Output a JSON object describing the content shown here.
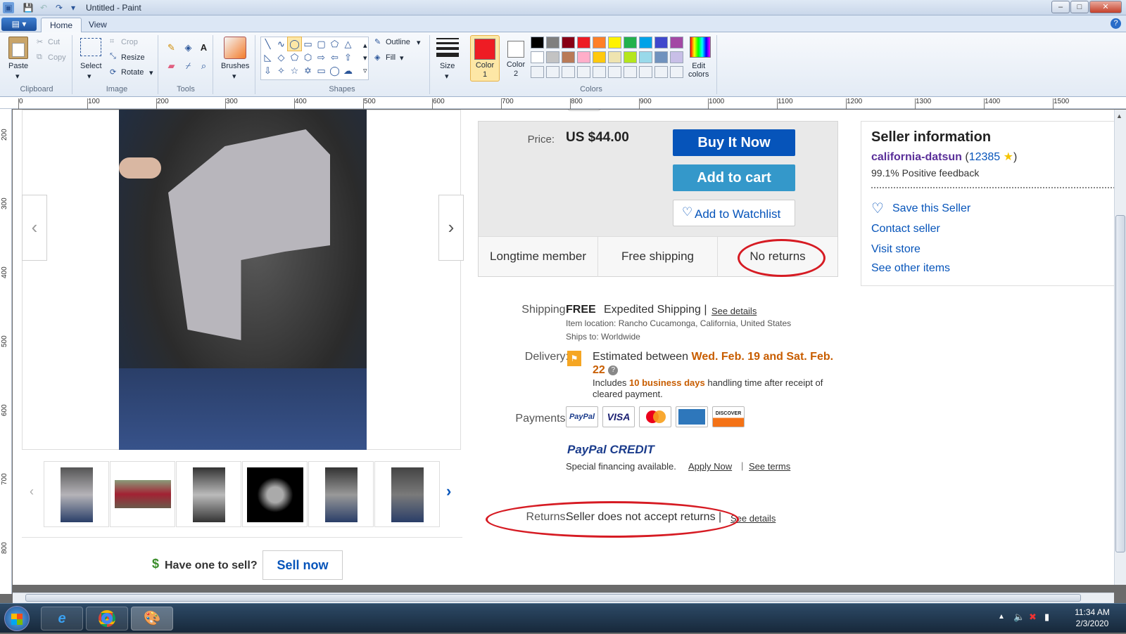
{
  "window": {
    "title": "Untitled - Paint",
    "min": "–",
    "max": "□",
    "close": "✕"
  },
  "ribbon": {
    "file_menu": "▤ ▾",
    "tabs": [
      "Home",
      "View"
    ],
    "clipboard": {
      "paste": "Paste",
      "cut": "Cut",
      "copy": "Copy",
      "label": "Clipboard"
    },
    "image": {
      "select": "Select",
      "crop": "Crop",
      "resize": "Resize",
      "rotate": "Rotate",
      "label": "Image"
    },
    "tools": {
      "label": "Tools"
    },
    "brushes": {
      "label": "Brushes"
    },
    "shapes": {
      "outline": "Outline",
      "fill": "Fill",
      "label": "Shapes"
    },
    "size": {
      "label": "Size"
    },
    "color1": {
      "label": "Color\n1",
      "value": "#ee1c24"
    },
    "color2": {
      "label": "Color\n2",
      "value": "#ffffff"
    },
    "colors": {
      "label": "Colors",
      "row1": [
        "#000000",
        "#7f7f7f",
        "#880015",
        "#ed1c24",
        "#ff7f27",
        "#fff200",
        "#22b14c",
        "#00a2e8",
        "#3f48cc",
        "#a349a4"
      ],
      "row2": [
        "#ffffff",
        "#c3c3c3",
        "#b97a57",
        "#ffaec9",
        "#ffc90e",
        "#efe4b0",
        "#b5e61d",
        "#99d9ea",
        "#7092be",
        "#c8bfe7"
      ]
    },
    "edit_colors": "Edit\ncolors"
  },
  "ruler": {
    "h": [
      "0",
      "100",
      "200",
      "300",
      "400",
      "500",
      "600",
      "700",
      "800",
      "900",
      "1000",
      "1100",
      "1200",
      "1300",
      "1400",
      "1500"
    ],
    "v": [
      "200",
      "300",
      "400",
      "500",
      "600",
      "700",
      "800"
    ]
  },
  "page": {
    "price_label": "Price:",
    "price": "US $44.00",
    "buy_now": "Buy It Now",
    "add_to_cart": "Add to cart",
    "watchlist": "Add to Watchlist",
    "badges": [
      "Longtime member",
      "Free shipping",
      "No returns"
    ],
    "shipping_label": "Shipping:",
    "shipping_free": "FREE",
    "shipping_method": "Expedited Shipping |",
    "see_details": "See details",
    "item_location": "Item location:  Rancho Cucamonga, California, United States",
    "ships_to": "Ships to:  Worldwide",
    "delivery_label": "Delivery:",
    "delivery_prefix": "Estimated between",
    "delivery_dates": "Wed. Feb. 19 and Sat. Feb. 22",
    "delivery_note_1": "Includes",
    "delivery_note_days": "10 business days",
    "delivery_note_2": "handling time after receipt of cleared payment.",
    "payments_label": "Payments:",
    "payment_methods": [
      "PayPal",
      "VISA",
      "MC",
      "AMEX",
      "DISCOVER"
    ],
    "paypal_credit": "PayPal CREDIT",
    "financing": "Special financing available.",
    "apply_now": "Apply Now",
    "see_terms": "See terms",
    "returns_label": "Returns:",
    "returns_value": "Seller does not accept returns |",
    "returns_details": "See details",
    "have_one": "Have one to sell?",
    "sell_now": "Sell now"
  },
  "seller": {
    "title": "Seller information",
    "name": "california-datsun",
    "score": "12385",
    "feedback": "99.1% Positive feedback",
    "save": "Save this Seller",
    "contact": "Contact seller",
    "visit": "Visit store",
    "other": "See other items"
  },
  "taskbar": {
    "time": "11:34 AM",
    "date": "2/3/2020"
  }
}
